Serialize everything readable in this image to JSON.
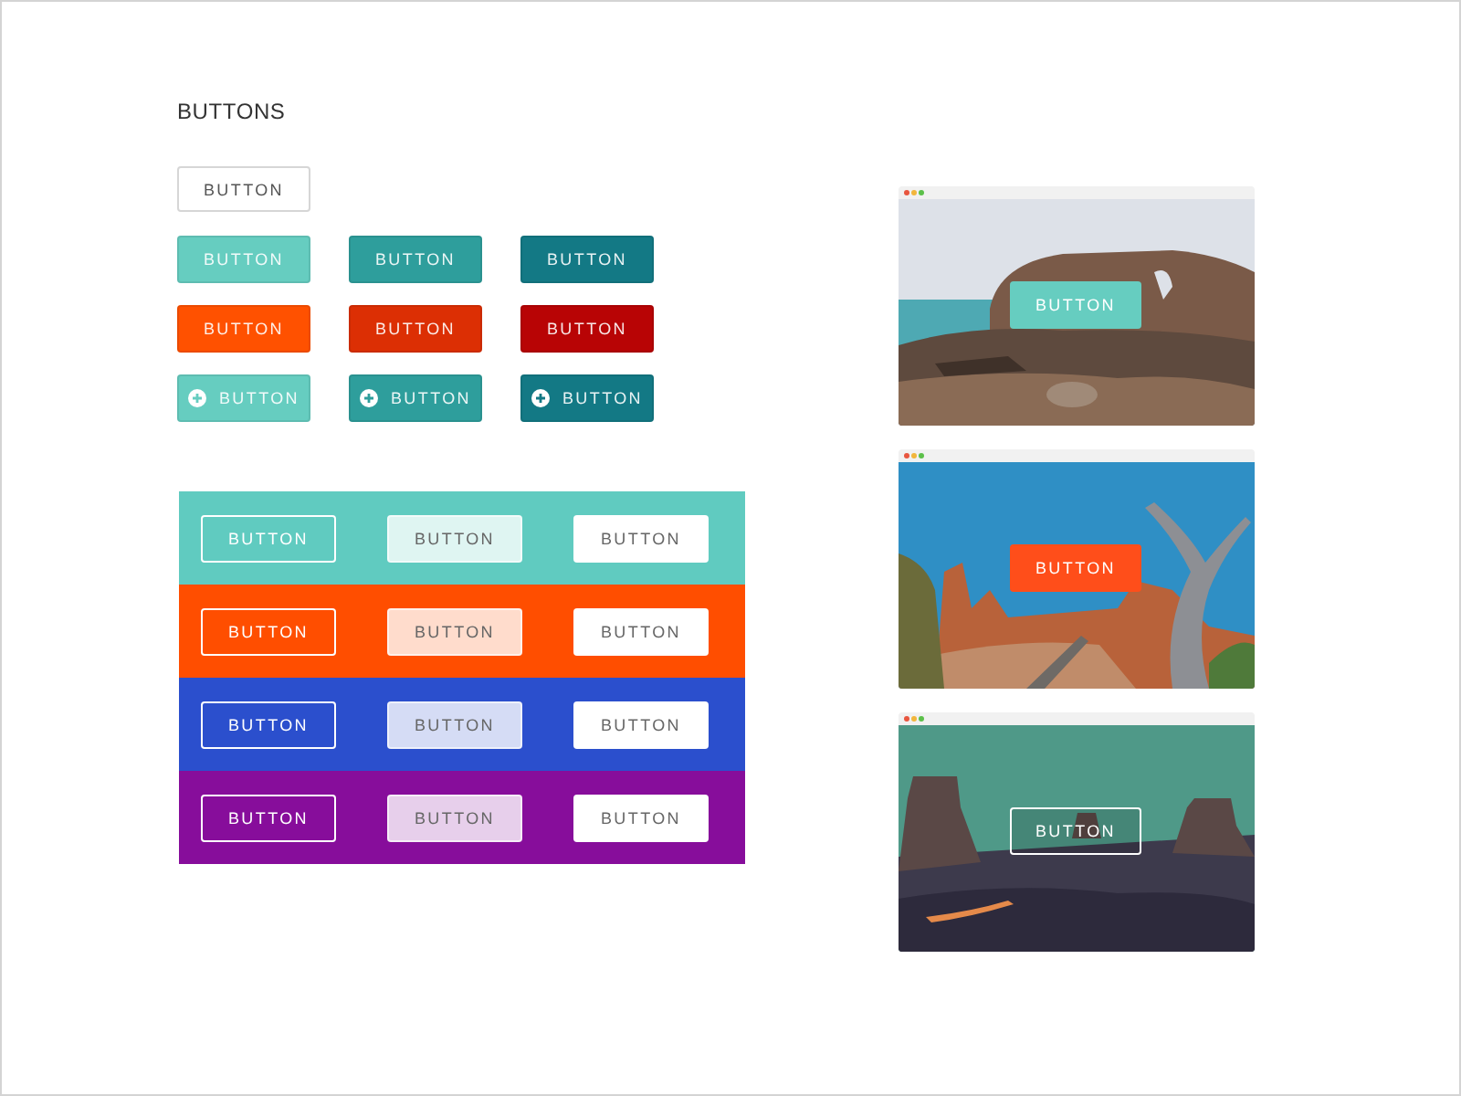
{
  "title": "BUTTONS",
  "outline_button": {
    "label": "BUTTON"
  },
  "button_rows": [
    {
      "kind": "plain",
      "buttons": [
        {
          "label": "BUTTON",
          "color": "#66cdc0"
        },
        {
          "label": "BUTTON",
          "color": "#2e9e9c"
        },
        {
          "label": "BUTTON",
          "color": "#137985"
        }
      ]
    },
    {
      "kind": "plain",
      "buttons": [
        {
          "label": "BUTTON",
          "color": "#ff5100"
        },
        {
          "label": "BUTTON",
          "color": "#dc2f04"
        },
        {
          "label": "BUTTON",
          "color": "#b80405"
        }
      ]
    },
    {
      "kind": "icon",
      "buttons": [
        {
          "label": "BUTTON",
          "color": "#66cdc0"
        },
        {
          "label": "BUTTON",
          "color": "#2e9e9c"
        },
        {
          "label": "BUTTON",
          "color": "#137985"
        }
      ]
    }
  ],
  "bands": [
    {
      "color": "#60cbc0",
      "buttons": [
        {
          "kind": "outline",
          "label": "BUTTON"
        },
        {
          "kind": "tint",
          "label": "BUTTON"
        },
        {
          "kind": "solid",
          "label": "BUTTON"
        }
      ]
    },
    {
      "color": "#ff4e00",
      "buttons": [
        {
          "kind": "outline",
          "label": "BUTTON"
        },
        {
          "kind": "tint",
          "label": "BUTTON"
        },
        {
          "kind": "solid",
          "label": "BUTTON"
        }
      ]
    },
    {
      "color": "#2b4fcd",
      "buttons": [
        {
          "kind": "outline",
          "label": "BUTTON"
        },
        {
          "kind": "tint",
          "label": "BUTTON"
        },
        {
          "kind": "solid",
          "label": "BUTTON"
        }
      ]
    },
    {
      "color": "#870d9b",
      "buttons": [
        {
          "kind": "outline",
          "label": "BUTTON"
        },
        {
          "kind": "tint",
          "label": "BUTTON"
        },
        {
          "kind": "solid",
          "label": "BUTTON"
        }
      ]
    }
  ],
  "previews": [
    {
      "button": {
        "kind": "solid",
        "label": "BUTTON",
        "color": "#66cdc0"
      }
    },
    {
      "button": {
        "kind": "solid",
        "label": "BUTTON",
        "color": "#ff4e1a"
      }
    },
    {
      "button": {
        "kind": "ghost",
        "label": "BUTTON"
      }
    }
  ]
}
